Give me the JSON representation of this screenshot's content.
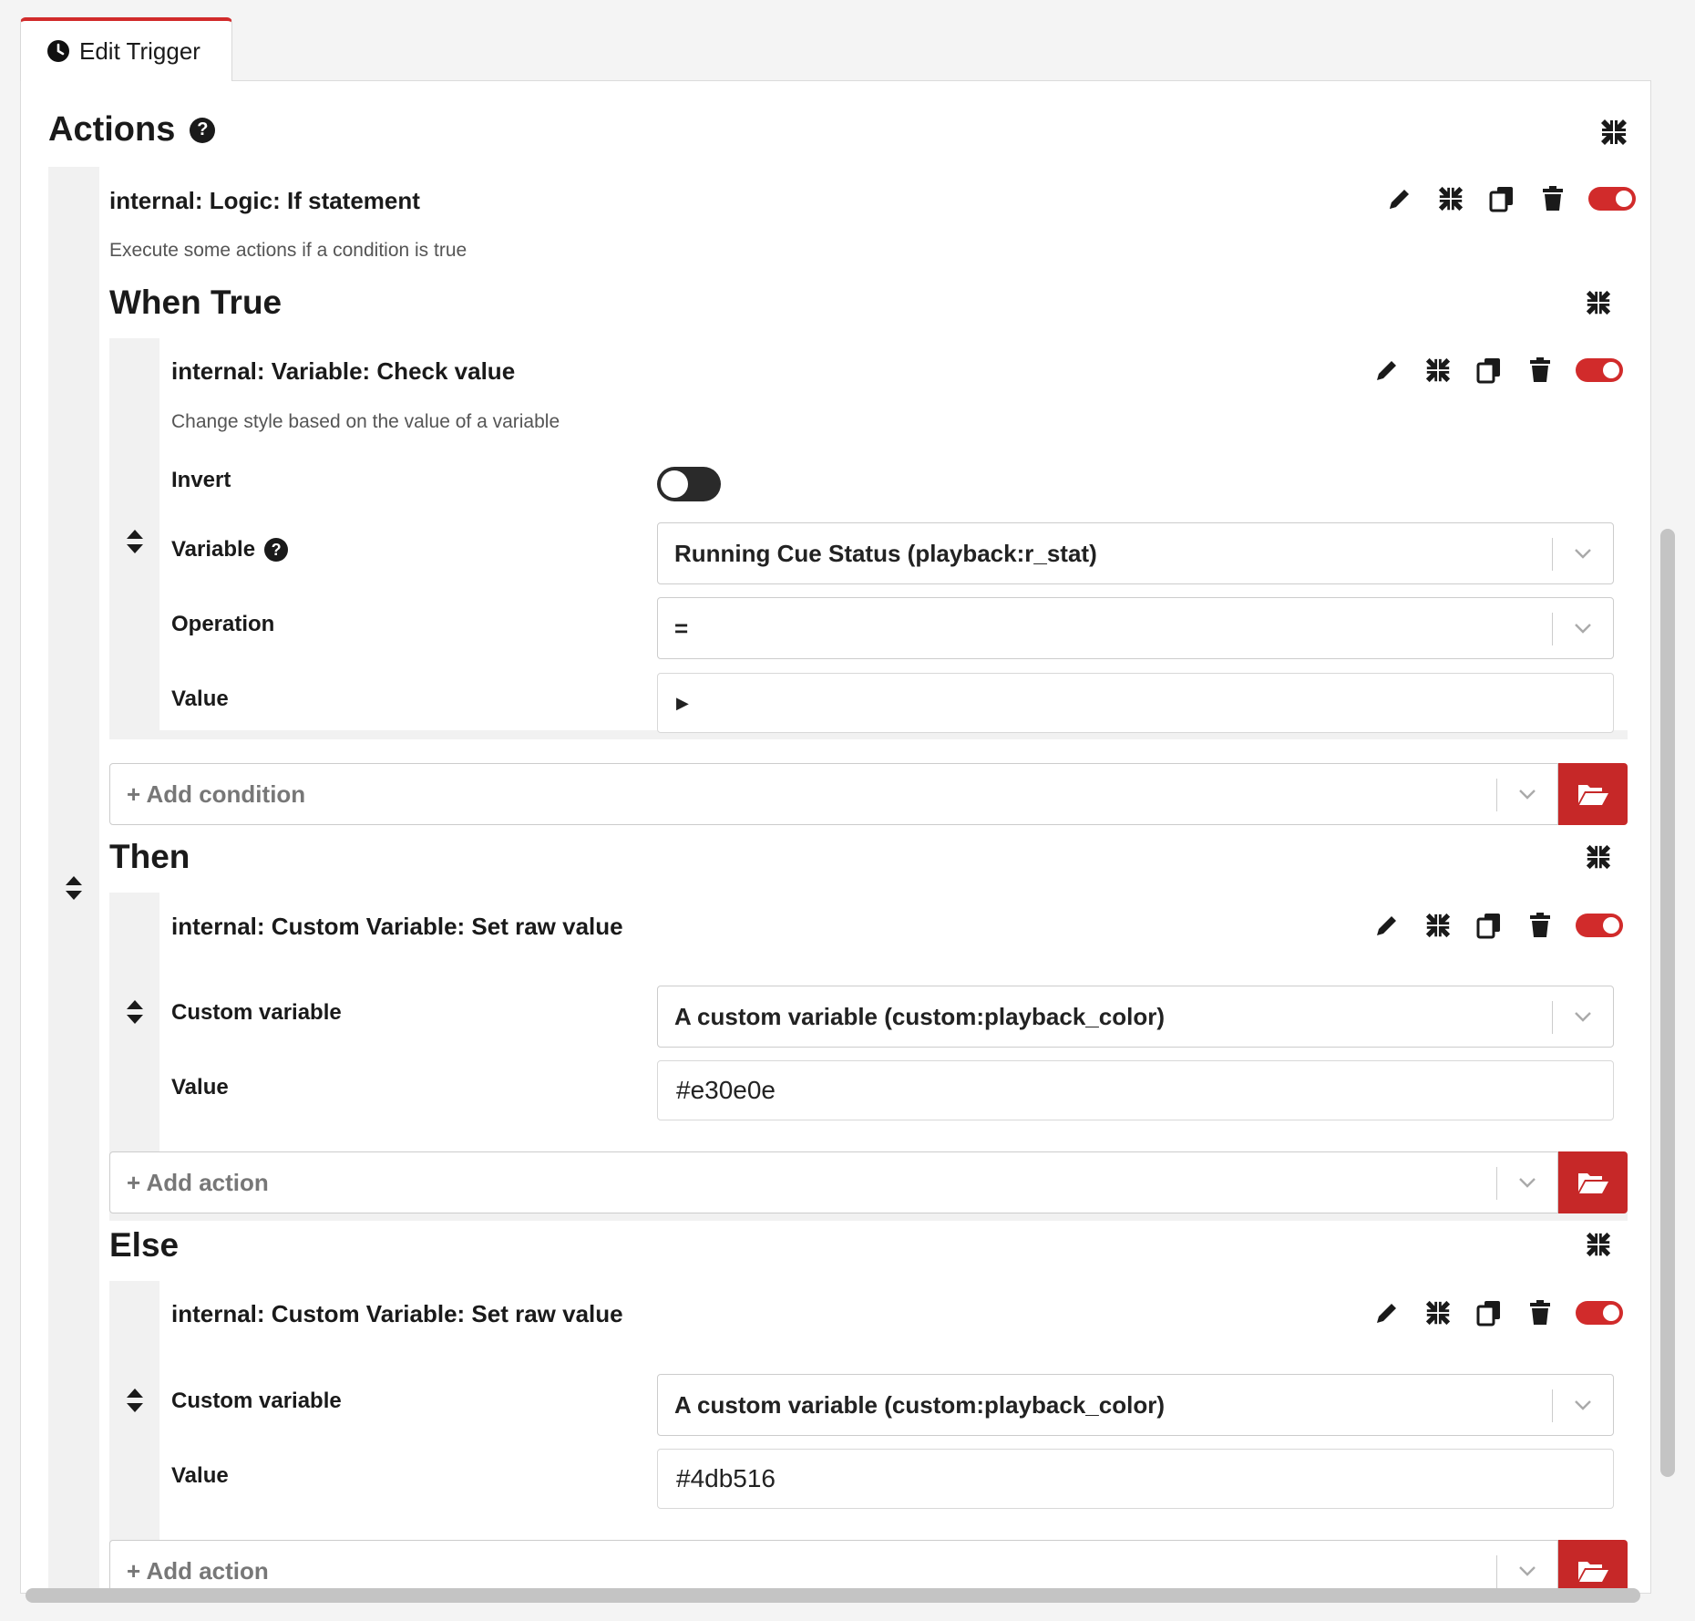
{
  "tab": {
    "label": "Edit Trigger",
    "icon": "clock-icon"
  },
  "section": {
    "title": "Actions",
    "help": "?"
  },
  "if_action": {
    "title": "internal: Logic: If statement",
    "description": "Execute some actions if a condition is true",
    "enabled": true
  },
  "when_true": {
    "title": "When True",
    "condition": {
      "title": "internal: Variable: Check value",
      "description": "Change style based on the value of a variable",
      "enabled": true,
      "fields": {
        "invert_label": "Invert",
        "invert_value": false,
        "variable_label": "Variable",
        "variable_help": "?",
        "variable_value": "Running Cue Status (playback:r_stat)",
        "operation_label": "Operation",
        "operation_value": "=",
        "value_label": "Value",
        "value_value": "▶"
      }
    },
    "add_label": "+ Add condition"
  },
  "then": {
    "title": "Then",
    "action": {
      "title": "internal: Custom Variable: Set raw value",
      "enabled": true,
      "custom_variable_label": "Custom variable",
      "custom_variable_value": "A custom variable (custom:playback_color)",
      "value_label": "Value",
      "value_value": "#e30e0e"
    },
    "add_label": "+ Add action"
  },
  "else": {
    "title": "Else",
    "action": {
      "title": "internal: Custom Variable: Set raw value",
      "enabled": true,
      "custom_variable_label": "Custom variable",
      "custom_variable_value": "A custom variable (custom:playback_color)",
      "value_label": "Value",
      "value_value": "#4db516"
    },
    "add_label": "+ Add action"
  },
  "colors": {
    "accent": "#d12b2b",
    "button": "#c62828",
    "gutter": "#f1f1f1"
  }
}
